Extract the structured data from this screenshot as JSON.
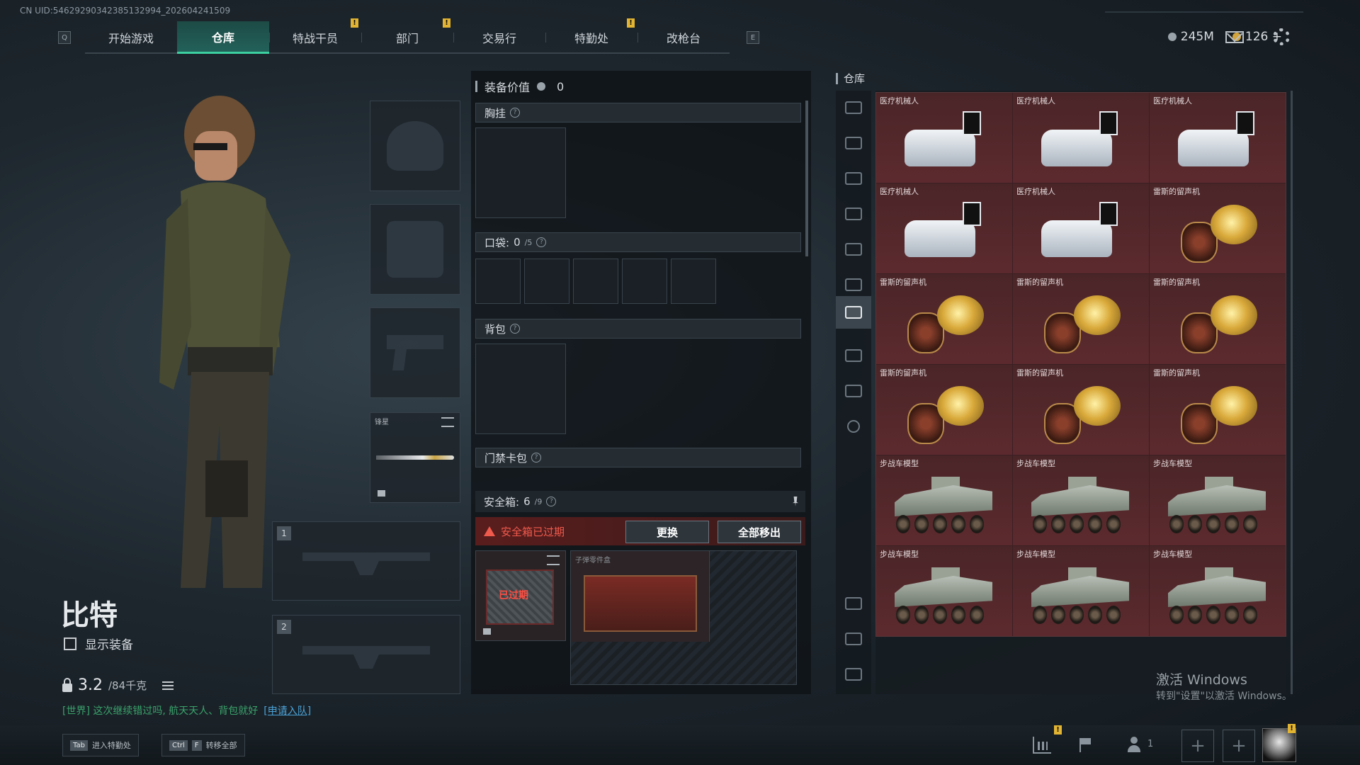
{
  "uid_text": "CN UID:5462929034238513​2994_202604241509",
  "nav": {
    "left_key": "Q",
    "right_key": "E",
    "tabs": [
      {
        "label": "开始游戏",
        "active": false,
        "badge": ""
      },
      {
        "label": "仓库",
        "active": true,
        "badge": ""
      },
      {
        "label": "特战干员",
        "active": false,
        "badge": "!"
      },
      {
        "label": "部门",
        "active": false,
        "badge": "!"
      },
      {
        "label": "交易行",
        "active": false,
        "badge": ""
      },
      {
        "label": "特勤处",
        "active": false,
        "badge": "!"
      },
      {
        "label": "改枪台",
        "active": false,
        "badge": ""
      }
    ]
  },
  "currency": {
    "silver": "245M",
    "gold": "126",
    "gold_add": "+"
  },
  "character": {
    "name": "比特",
    "show_equipment_label": "显示装备",
    "weight_value": "3.2",
    "weight_max": "/84千克"
  },
  "chat": {
    "text": "[世界] 这次继续错过吗, 航天天人、背包就好",
    "join": "[申请入队]"
  },
  "equipment": {
    "melee_label": "锋星",
    "weapon_slot_1": "1",
    "weapon_slot_2": "2"
  },
  "loadout": {
    "value_label": "装备价值",
    "value": "0",
    "chest_rig": "胸挂",
    "pocket_label": "口袋:",
    "pocket_count": "0",
    "pocket_max": "/5",
    "backpack": "背包",
    "keycard": "门禁卡包",
    "safe_label": "安全箱:",
    "safe_count": "6",
    "safe_max": "/9",
    "expired_notice": "安全箱已过期",
    "replace_button": "更换",
    "remove_all_button": "全部移出",
    "case_expired_text": "已过期",
    "safe_item_label": "子弹零件盒",
    "help_mark": "?"
  },
  "storage": {
    "title": "仓库",
    "items": [
      {
        "label": "医疗机械人",
        "kind": "robot"
      },
      {
        "label": "医疗机械人",
        "kind": "robot"
      },
      {
        "label": "医疗机械人",
        "kind": "robot"
      },
      {
        "label": "医疗机械人",
        "kind": "robot"
      },
      {
        "label": "医疗机械人",
        "kind": "robot"
      },
      {
        "label": "雷斯的留声机",
        "kind": "phonograph"
      },
      {
        "label": "雷斯的留声机",
        "kind": "phonograph"
      },
      {
        "label": "雷斯的留声机",
        "kind": "phonograph"
      },
      {
        "label": "雷斯的留声机",
        "kind": "phonograph"
      },
      {
        "label": "雷斯的留声机",
        "kind": "phonograph"
      },
      {
        "label": "雷斯的留声机",
        "kind": "phonograph"
      },
      {
        "label": "雷斯的留声机",
        "kind": "phonograph"
      },
      {
        "label": "步战车模型",
        "kind": "apc"
      },
      {
        "label": "步战车模型",
        "kind": "apc"
      },
      {
        "label": "步战车模型",
        "kind": "apc"
      },
      {
        "label": "步战车模型",
        "kind": "apc"
      },
      {
        "label": "步战车模型",
        "kind": "apc"
      },
      {
        "label": "步战车模型",
        "kind": "apc"
      }
    ]
  },
  "watermark": {
    "line1": "激活 Windows",
    "line2": "转到\"设置\"以激活 Windows。"
  },
  "bottom": {
    "hint1_key": "Tab",
    "hint1_text": "进入特勤处",
    "hint2_key1": "Ctrl",
    "hint2_key2": "F",
    "hint2_text": "转移全部",
    "team_count": "1",
    "add": "+"
  },
  "colors": {
    "accent": "#3ccf9f",
    "badge": "#e2b431",
    "expired": "#f05a4c",
    "cell_bg": "#5c2a2e"
  }
}
